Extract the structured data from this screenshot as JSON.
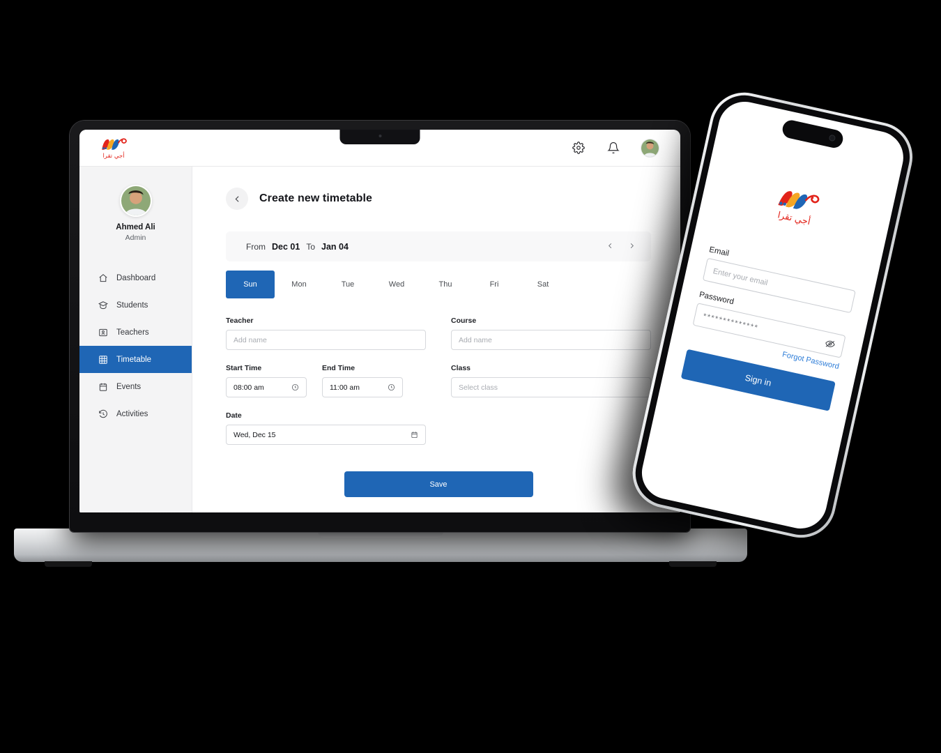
{
  "brand": {
    "arabic_name": "أجي تقرا",
    "logo_colors": [
      "#e2231a",
      "#f5a623",
      "#1f66b5"
    ],
    "accent_blue": "#1f66b5",
    "logo_icon": "swoosh-logo"
  },
  "laptop": {
    "topbar": {
      "settings_icon": "gear-icon",
      "notifications_icon": "bell-icon",
      "avatar_icon": "user-avatar"
    },
    "sidebar": {
      "profile": {
        "name": "Ahmed Ali",
        "role": "Admin",
        "avatar_icon": "user-avatar"
      },
      "items": [
        {
          "label": "Dashboard",
          "icon": "home-icon",
          "active": false
        },
        {
          "label": "Students",
          "icon": "graduate-icon",
          "active": false
        },
        {
          "label": "Teachers",
          "icon": "teacher-icon",
          "active": false
        },
        {
          "label": "Timetable",
          "icon": "grid-icon",
          "active": true
        },
        {
          "label": "Events",
          "icon": "calendar-icon",
          "active": false
        },
        {
          "label": "Activities",
          "icon": "history-icon",
          "active": false
        }
      ]
    },
    "page": {
      "title": "Create new timetable",
      "back_icon": "chevron-left-icon",
      "range": {
        "from_label": "From",
        "from_value": "Dec 01",
        "to_label": "To",
        "to_value": "Jan 04",
        "prev_icon": "chevron-left-icon",
        "next_icon": "chevron-right-icon"
      },
      "days": [
        {
          "label": "Sun",
          "active": true
        },
        {
          "label": "Mon",
          "active": false
        },
        {
          "label": "Tue",
          "active": false
        },
        {
          "label": "Wed",
          "active": false
        },
        {
          "label": "Thu",
          "active": false
        },
        {
          "label": "Fri",
          "active": false
        },
        {
          "label": "Sat",
          "active": false
        }
      ],
      "fields": {
        "teacher": {
          "label": "Teacher",
          "placeholder": "Add name"
        },
        "course": {
          "label": "Course",
          "placeholder": "Add name"
        },
        "start_time": {
          "label": "Start Time",
          "value": "08:00 am",
          "icon": "clock-icon"
        },
        "end_time": {
          "label": "End Time",
          "value": "11:00 am",
          "icon": "clock-icon"
        },
        "class": {
          "label": "Class",
          "placeholder": "Select class"
        },
        "date": {
          "label": "Date",
          "value": "Wed, Dec 15",
          "icon": "calendar-icon"
        }
      },
      "save_label": "Save"
    }
  },
  "phone": {
    "login": {
      "email_label": "Email",
      "email_placeholder": "Enter your email",
      "password_label": "Password",
      "password_value": "**************",
      "password_toggle_icon": "eye-off-icon",
      "forgot_label": "Forgot Password",
      "signin_label": "Sign in"
    }
  }
}
